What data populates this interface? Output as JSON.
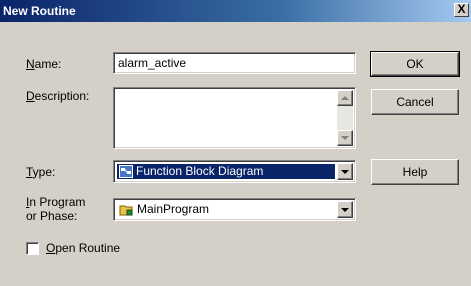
{
  "window": {
    "title": "New Routine",
    "close_glyph": "X"
  },
  "form": {
    "name": {
      "label_key": "N",
      "label_rest": "ame:",
      "value": "alarm_active"
    },
    "description": {
      "label_key": "D",
      "label_rest": "escription:",
      "value": ""
    },
    "type": {
      "label_key": "T",
      "label_rest": "ype:",
      "selected": "Function Block Diagram",
      "icon": "function-block-diagram-icon"
    },
    "program": {
      "label_key": "I",
      "label_rest": "n Program",
      "label_line2": "or Phase:",
      "selected": "MainProgram",
      "icon": "program-folder-icon"
    },
    "open_routine": {
      "label_key": "O",
      "label_rest": "pen Routine",
      "checked": false
    }
  },
  "buttons": {
    "ok": "OK",
    "cancel": "Cancel",
    "help": "Help"
  },
  "colors": {
    "title_start": "#0a246a",
    "title_end": "#a6caf0",
    "selection": "#0a246a",
    "face": "#d4d0c8"
  }
}
